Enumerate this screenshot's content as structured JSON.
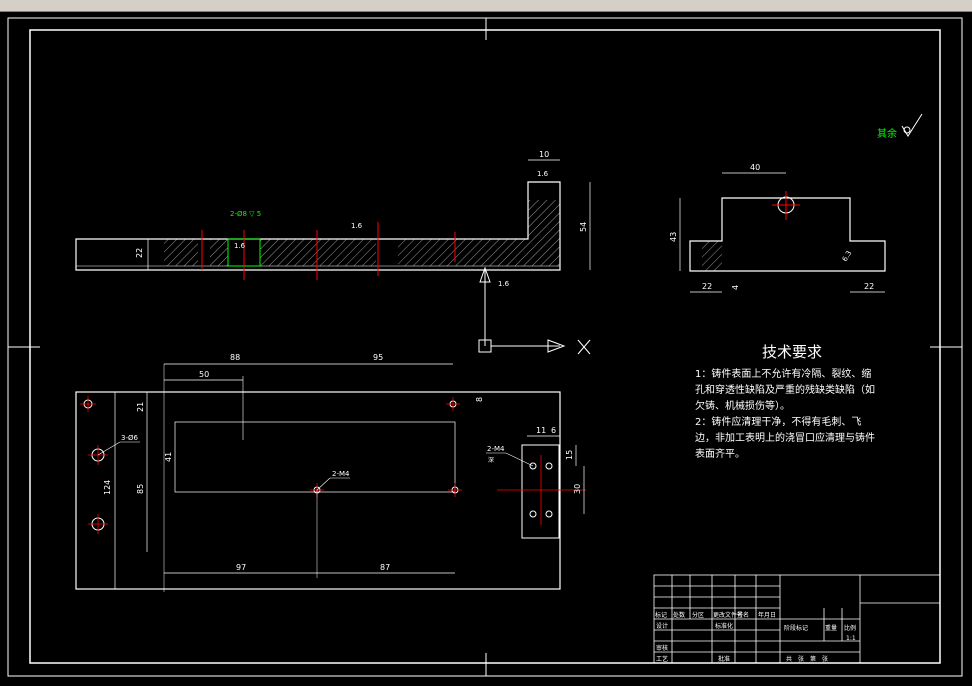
{
  "colors": {
    "background": "#000000",
    "outline": "#ffffff",
    "centerline": "#ff0000",
    "dimension": "#ffffff",
    "accent": "#00ff00"
  },
  "roughness_corner": "其余",
  "section_view": {
    "dims": {
      "thickness": "22",
      "step_width": "10",
      "height": "54"
    },
    "roughness": [
      "1.6",
      "1.6",
      "1.6",
      "1.6"
    ],
    "counterbore_note": "2-Ø8 ▽ 5"
  },
  "side_view": {
    "dims": {
      "top": "40",
      "height": "43",
      "bottom_left": "22",
      "bottom_right": "22",
      "small": "4"
    },
    "roughness": "6.3"
  },
  "plan_view": {
    "dims": {
      "top_a": "88",
      "top_b": "95",
      "top_c": "50",
      "left_a": "21",
      "left_b": "41",
      "left_c": "85",
      "left_d": "124",
      "bottom_a": "97",
      "bottom_b": "87",
      "right_a": "8",
      "right_b": "11",
      "right_c": "6",
      "right_d": "15",
      "right_e": "30"
    },
    "callouts": {
      "holes_large": "3-Ø6",
      "holes_thread": "2-M4",
      "holes_pair": "2-M4",
      "pair_note": "深"
    }
  },
  "tech_requirements": {
    "title": "技术要求",
    "lines": [
      "1：铸件表面上不允许有冷隔、裂纹、缩",
      "孔和穿透性缺陷及严重的残缺类缺陷（如",
      "欠铸、机械损伤等）。",
      "2：铸件应清理干净，不得有毛刺、飞",
      "边，非加工表明上的浇冒口应清理与铸件",
      "表面齐平。"
    ]
  },
  "title_block": {
    "row_labels": [
      "标记",
      "处数",
      "分区",
      "更改文件号",
      "签名",
      "年月日"
    ],
    "designer": "设计",
    "standard": "标准化",
    "review": "审核",
    "process": "工艺",
    "approve": "批准",
    "stage": "阶段标记",
    "weight": "重量",
    "scale_label": "比例",
    "scale": "1:1",
    "sheets": "共　张　第　张"
  }
}
